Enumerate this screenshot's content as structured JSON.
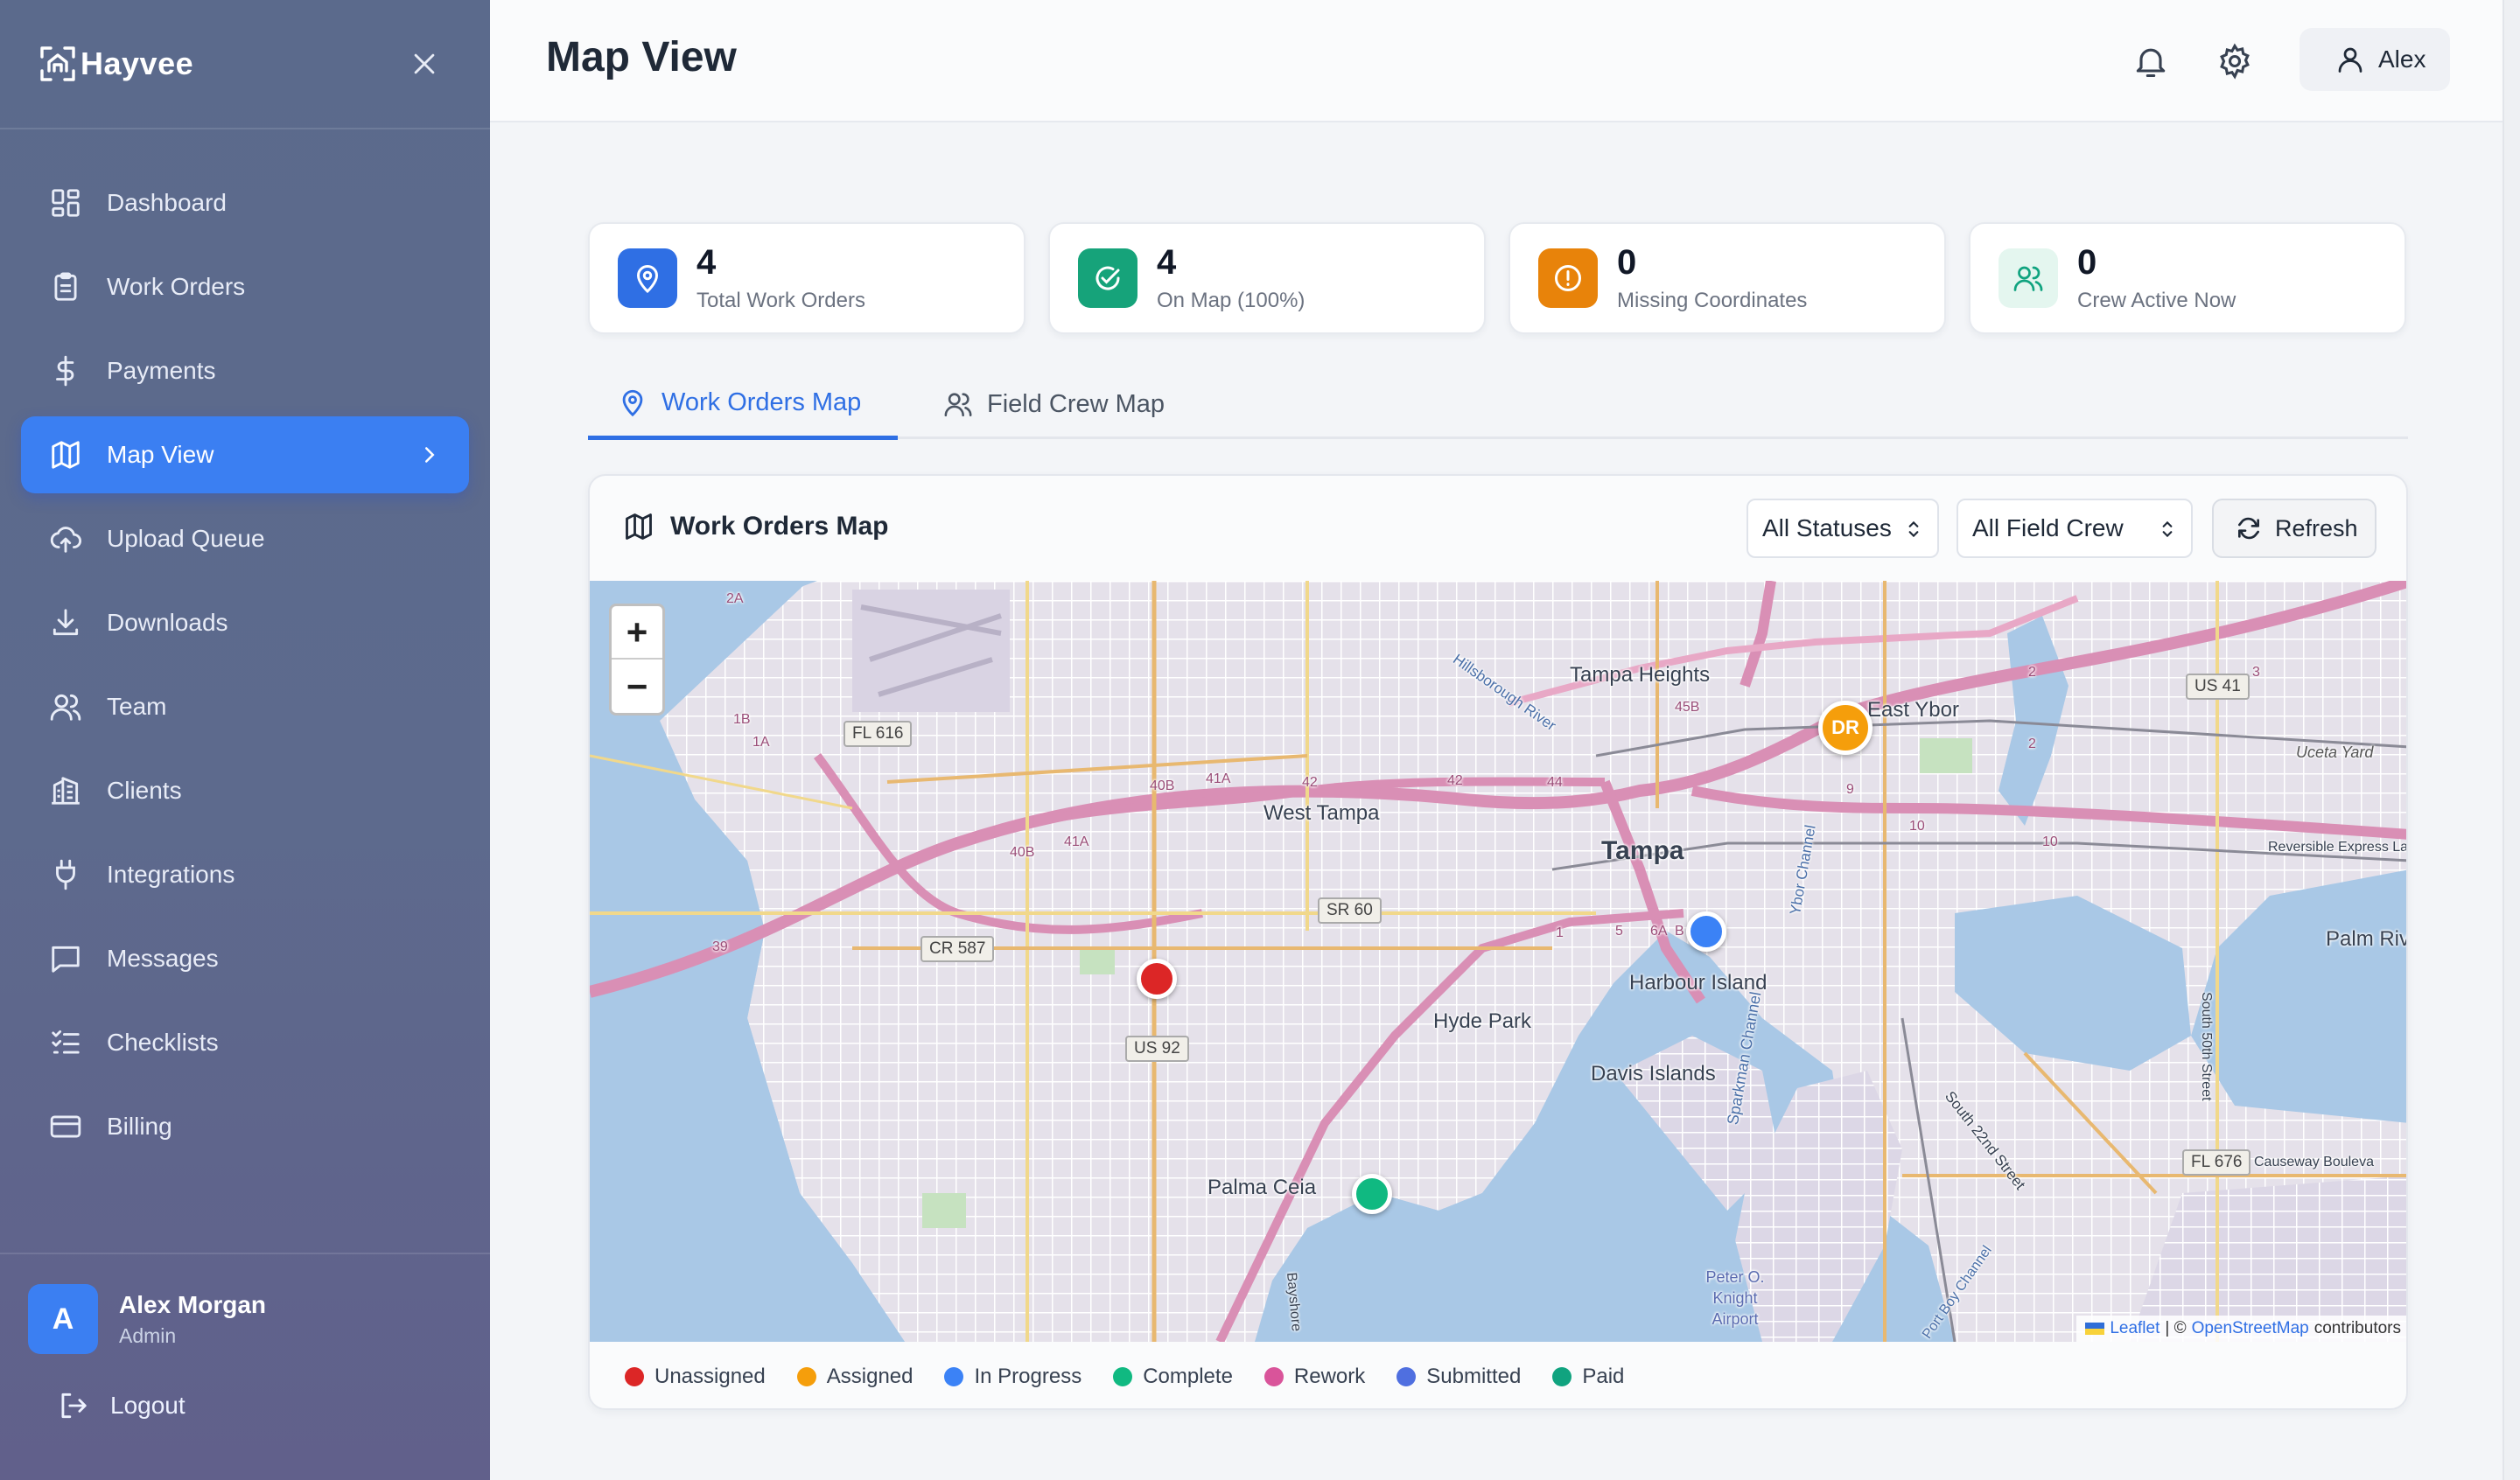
{
  "brand": {
    "name": "Hayvee"
  },
  "sidebar": {
    "items": [
      {
        "label": "Dashboard",
        "icon": "dashboard-icon"
      },
      {
        "label": "Work Orders",
        "icon": "clipboard-icon"
      },
      {
        "label": "Payments",
        "icon": "dollar-icon"
      },
      {
        "label": "Map View",
        "icon": "map-icon",
        "active": true
      },
      {
        "label": "Upload Queue",
        "icon": "cloud-upload-icon"
      },
      {
        "label": "Downloads",
        "icon": "download-icon"
      },
      {
        "label": "Team",
        "icon": "users-icon"
      },
      {
        "label": "Clients",
        "icon": "building-icon"
      },
      {
        "label": "Integrations",
        "icon": "plug-icon"
      },
      {
        "label": "Messages",
        "icon": "message-icon"
      },
      {
        "label": "Checklists",
        "icon": "checklist-icon"
      },
      {
        "label": "Billing",
        "icon": "card-icon"
      }
    ],
    "user": {
      "initial": "A",
      "name": "Alex Morgan",
      "role": "Admin"
    },
    "logout_label": "Logout"
  },
  "header": {
    "title": "Map View",
    "user_label": "Alex"
  },
  "stats": [
    {
      "value": "4",
      "label": "Total Work Orders",
      "icon": "map-pin-icon",
      "color": "#2f6fe4"
    },
    {
      "value": "4",
      "label": "On Map (100%)",
      "icon": "check-circle-icon",
      "color": "#16a37a"
    },
    {
      "value": "0",
      "label": "Missing Coordinates",
      "icon": "alert-circle-icon",
      "color": "#e8830a"
    },
    {
      "value": "0",
      "label": "Crew Active Now",
      "icon": "users-icon",
      "color": "#10a37f"
    }
  ],
  "tabs": [
    {
      "label": "Work Orders Map",
      "active": true
    },
    {
      "label": "Field Crew Map",
      "active": false
    }
  ],
  "map_card": {
    "title": "Work Orders Map",
    "status_filter": "All Statuses",
    "crew_filter": "All Field Crew",
    "refresh_label": "Refresh"
  },
  "map": {
    "zoom_in": "+",
    "zoom_out": "−",
    "crew_marker": "DR",
    "markers": [
      {
        "status": "Unassigned",
        "color": "#dc2626"
      },
      {
        "status": "In Progress",
        "color": "#3b82f6"
      },
      {
        "status": "Complete",
        "color": "#10b981"
      }
    ],
    "labels": [
      "Tampa Heights",
      "East Ybor",
      "West Tampa",
      "Tampa",
      "Harbour Island",
      "Hyde Park",
      "Davis Islands",
      "Palma Ceia",
      "Palm Riv",
      "Peter O. Knight Airport",
      "Uceta Yard",
      "Sparkman Channel",
      "South 22nd Street",
      "South 50th Street",
      "Causeway Bouleva",
      "Hillsborough River",
      "Reversible Express La",
      "Ybor Channel",
      "Bayshore",
      "Port Boy Channel"
    ],
    "shields": [
      "FL 616",
      "CR 587",
      "SR 60",
      "US 92",
      "US 41",
      "FL 676"
    ],
    "route_numbers": [
      "2A",
      "1B",
      "1A",
      "40B",
      "41A",
      "42",
      "44",
      "45B",
      "39",
      "40B",
      "41A",
      "42",
      "2",
      "3",
      "9",
      "10",
      "1",
      "5",
      "6A",
      "B",
      "10",
      "2"
    ],
    "attribution": {
      "leaflet": "Leaflet",
      "sep": "| ©",
      "osm": "OpenStreetMap",
      "contrib": "contributors"
    }
  },
  "legend": [
    {
      "label": "Unassigned",
      "color": "#dc2626"
    },
    {
      "label": "Assigned",
      "color": "#f59e0b"
    },
    {
      "label": "In Progress",
      "color": "#3b82f6"
    },
    {
      "label": "Complete",
      "color": "#10b981"
    },
    {
      "label": "Rework",
      "color": "#d9549a"
    },
    {
      "label": "Submitted",
      "color": "#4f6fe0"
    },
    {
      "label": "Paid",
      "color": "#10a37f"
    }
  ]
}
